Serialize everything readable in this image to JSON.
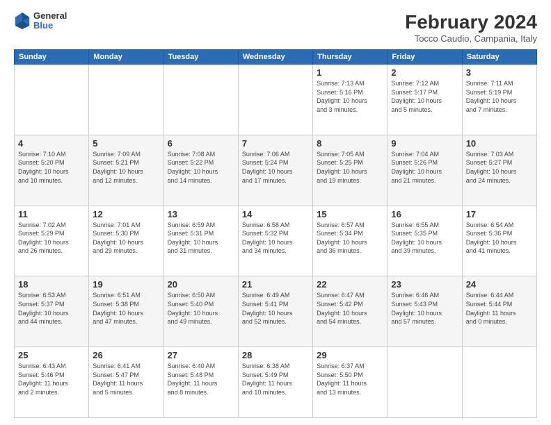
{
  "header": {
    "logo_general": "General",
    "logo_blue": "Blue",
    "month_title": "February 2024",
    "location": "Tocco Caudio, Campania, Italy"
  },
  "weekdays": [
    "Sunday",
    "Monday",
    "Tuesday",
    "Wednesday",
    "Thursday",
    "Friday",
    "Saturday"
  ],
  "weeks": [
    [
      {
        "day": "",
        "info": ""
      },
      {
        "day": "",
        "info": ""
      },
      {
        "day": "",
        "info": ""
      },
      {
        "day": "",
        "info": ""
      },
      {
        "day": "1",
        "info": "Sunrise: 7:13 AM\nSunset: 5:16 PM\nDaylight: 10 hours\nand 3 minutes."
      },
      {
        "day": "2",
        "info": "Sunrise: 7:12 AM\nSunset: 5:17 PM\nDaylight: 10 hours\nand 5 minutes."
      },
      {
        "day": "3",
        "info": "Sunrise: 7:11 AM\nSunset: 5:19 PM\nDaylight: 10 hours\nand 7 minutes."
      }
    ],
    [
      {
        "day": "4",
        "info": "Sunrise: 7:10 AM\nSunset: 5:20 PM\nDaylight: 10 hours\nand 10 minutes."
      },
      {
        "day": "5",
        "info": "Sunrise: 7:09 AM\nSunset: 5:21 PM\nDaylight: 10 hours\nand 12 minutes."
      },
      {
        "day": "6",
        "info": "Sunrise: 7:08 AM\nSunset: 5:22 PM\nDaylight: 10 hours\nand 14 minutes."
      },
      {
        "day": "7",
        "info": "Sunrise: 7:06 AM\nSunset: 5:24 PM\nDaylight: 10 hours\nand 17 minutes."
      },
      {
        "day": "8",
        "info": "Sunrise: 7:05 AM\nSunset: 5:25 PM\nDaylight: 10 hours\nand 19 minutes."
      },
      {
        "day": "9",
        "info": "Sunrise: 7:04 AM\nSunset: 5:26 PM\nDaylight: 10 hours\nand 21 minutes."
      },
      {
        "day": "10",
        "info": "Sunrise: 7:03 AM\nSunset: 5:27 PM\nDaylight: 10 hours\nand 24 minutes."
      }
    ],
    [
      {
        "day": "11",
        "info": "Sunrise: 7:02 AM\nSunset: 5:29 PM\nDaylight: 10 hours\nand 26 minutes."
      },
      {
        "day": "12",
        "info": "Sunrise: 7:01 AM\nSunset: 5:30 PM\nDaylight: 10 hours\nand 29 minutes."
      },
      {
        "day": "13",
        "info": "Sunrise: 6:59 AM\nSunset: 5:31 PM\nDaylight: 10 hours\nand 31 minutes."
      },
      {
        "day": "14",
        "info": "Sunrise: 6:58 AM\nSunset: 5:32 PM\nDaylight: 10 hours\nand 34 minutes."
      },
      {
        "day": "15",
        "info": "Sunrise: 6:57 AM\nSunset: 5:34 PM\nDaylight: 10 hours\nand 36 minutes."
      },
      {
        "day": "16",
        "info": "Sunrise: 6:55 AM\nSunset: 5:35 PM\nDaylight: 10 hours\nand 39 minutes."
      },
      {
        "day": "17",
        "info": "Sunrise: 6:54 AM\nSunset: 5:36 PM\nDaylight: 10 hours\nand 41 minutes."
      }
    ],
    [
      {
        "day": "18",
        "info": "Sunrise: 6:53 AM\nSunset: 5:37 PM\nDaylight: 10 hours\nand 44 minutes."
      },
      {
        "day": "19",
        "info": "Sunrise: 6:51 AM\nSunset: 5:38 PM\nDaylight: 10 hours\nand 47 minutes."
      },
      {
        "day": "20",
        "info": "Sunrise: 6:50 AM\nSunset: 5:40 PM\nDaylight: 10 hours\nand 49 minutes."
      },
      {
        "day": "21",
        "info": "Sunrise: 6:49 AM\nSunset: 5:41 PM\nDaylight: 10 hours\nand 52 minutes."
      },
      {
        "day": "22",
        "info": "Sunrise: 6:47 AM\nSunset: 5:42 PM\nDaylight: 10 hours\nand 54 minutes."
      },
      {
        "day": "23",
        "info": "Sunrise: 6:46 AM\nSunset: 5:43 PM\nDaylight: 10 hours\nand 57 minutes."
      },
      {
        "day": "24",
        "info": "Sunrise: 6:44 AM\nSunset: 5:44 PM\nDaylight: 11 hours\nand 0 minutes."
      }
    ],
    [
      {
        "day": "25",
        "info": "Sunrise: 6:43 AM\nSunset: 5:46 PM\nDaylight: 11 hours\nand 2 minutes."
      },
      {
        "day": "26",
        "info": "Sunrise: 6:41 AM\nSunset: 5:47 PM\nDaylight: 11 hours\nand 5 minutes."
      },
      {
        "day": "27",
        "info": "Sunrise: 6:40 AM\nSunset: 5:48 PM\nDaylight: 11 hours\nand 8 minutes."
      },
      {
        "day": "28",
        "info": "Sunrise: 6:38 AM\nSunset: 5:49 PM\nDaylight: 11 hours\nand 10 minutes."
      },
      {
        "day": "29",
        "info": "Sunrise: 6:37 AM\nSunset: 5:50 PM\nDaylight: 11 hours\nand 13 minutes."
      },
      {
        "day": "",
        "info": ""
      },
      {
        "day": "",
        "info": ""
      }
    ]
  ]
}
